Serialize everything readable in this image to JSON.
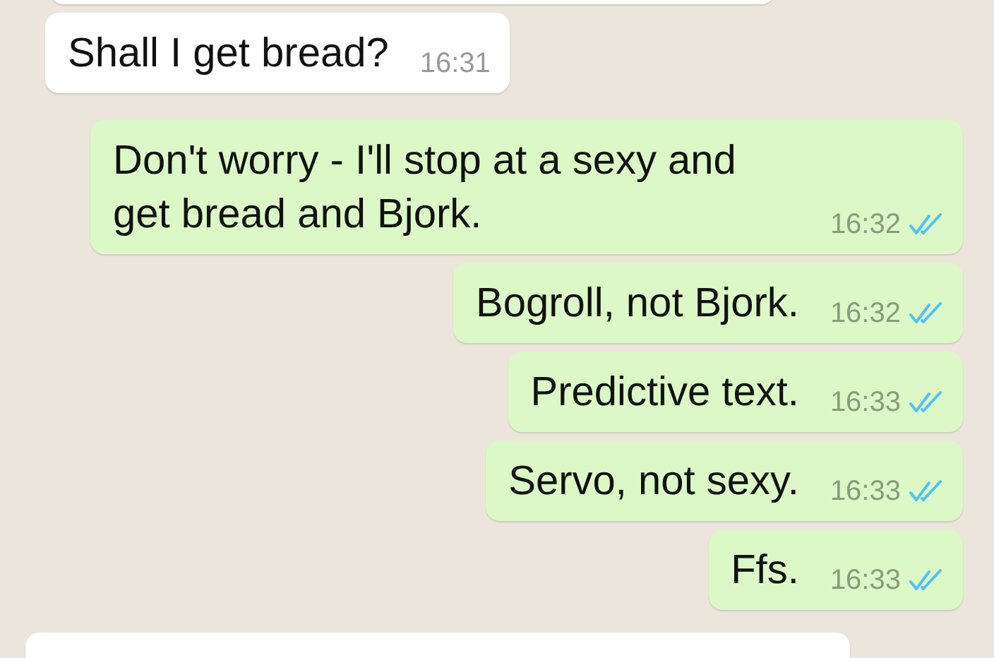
{
  "messages": [
    {
      "kind": "incoming",
      "clipped": true
    },
    {
      "kind": "incoming",
      "text": "Shall I get bread?",
      "time": "16:31"
    },
    {
      "kind": "outgoing",
      "text": "Don't worry - I'll stop at a sexy and get bread and Bjork.",
      "time": "16:32",
      "read": true
    },
    {
      "kind": "outgoing",
      "text": "Bogroll, not Bjork.",
      "time": "16:32",
      "read": true
    },
    {
      "kind": "outgoing",
      "text": "Predictive text.",
      "time": "16:33",
      "read": true
    },
    {
      "kind": "outgoing",
      "text": "Servo, not sexy.",
      "time": "16:33",
      "read": true
    },
    {
      "kind": "outgoing",
      "text": "Ffs.",
      "time": "16:33",
      "read": true
    },
    {
      "kind": "incoming",
      "clipped": true
    }
  ]
}
